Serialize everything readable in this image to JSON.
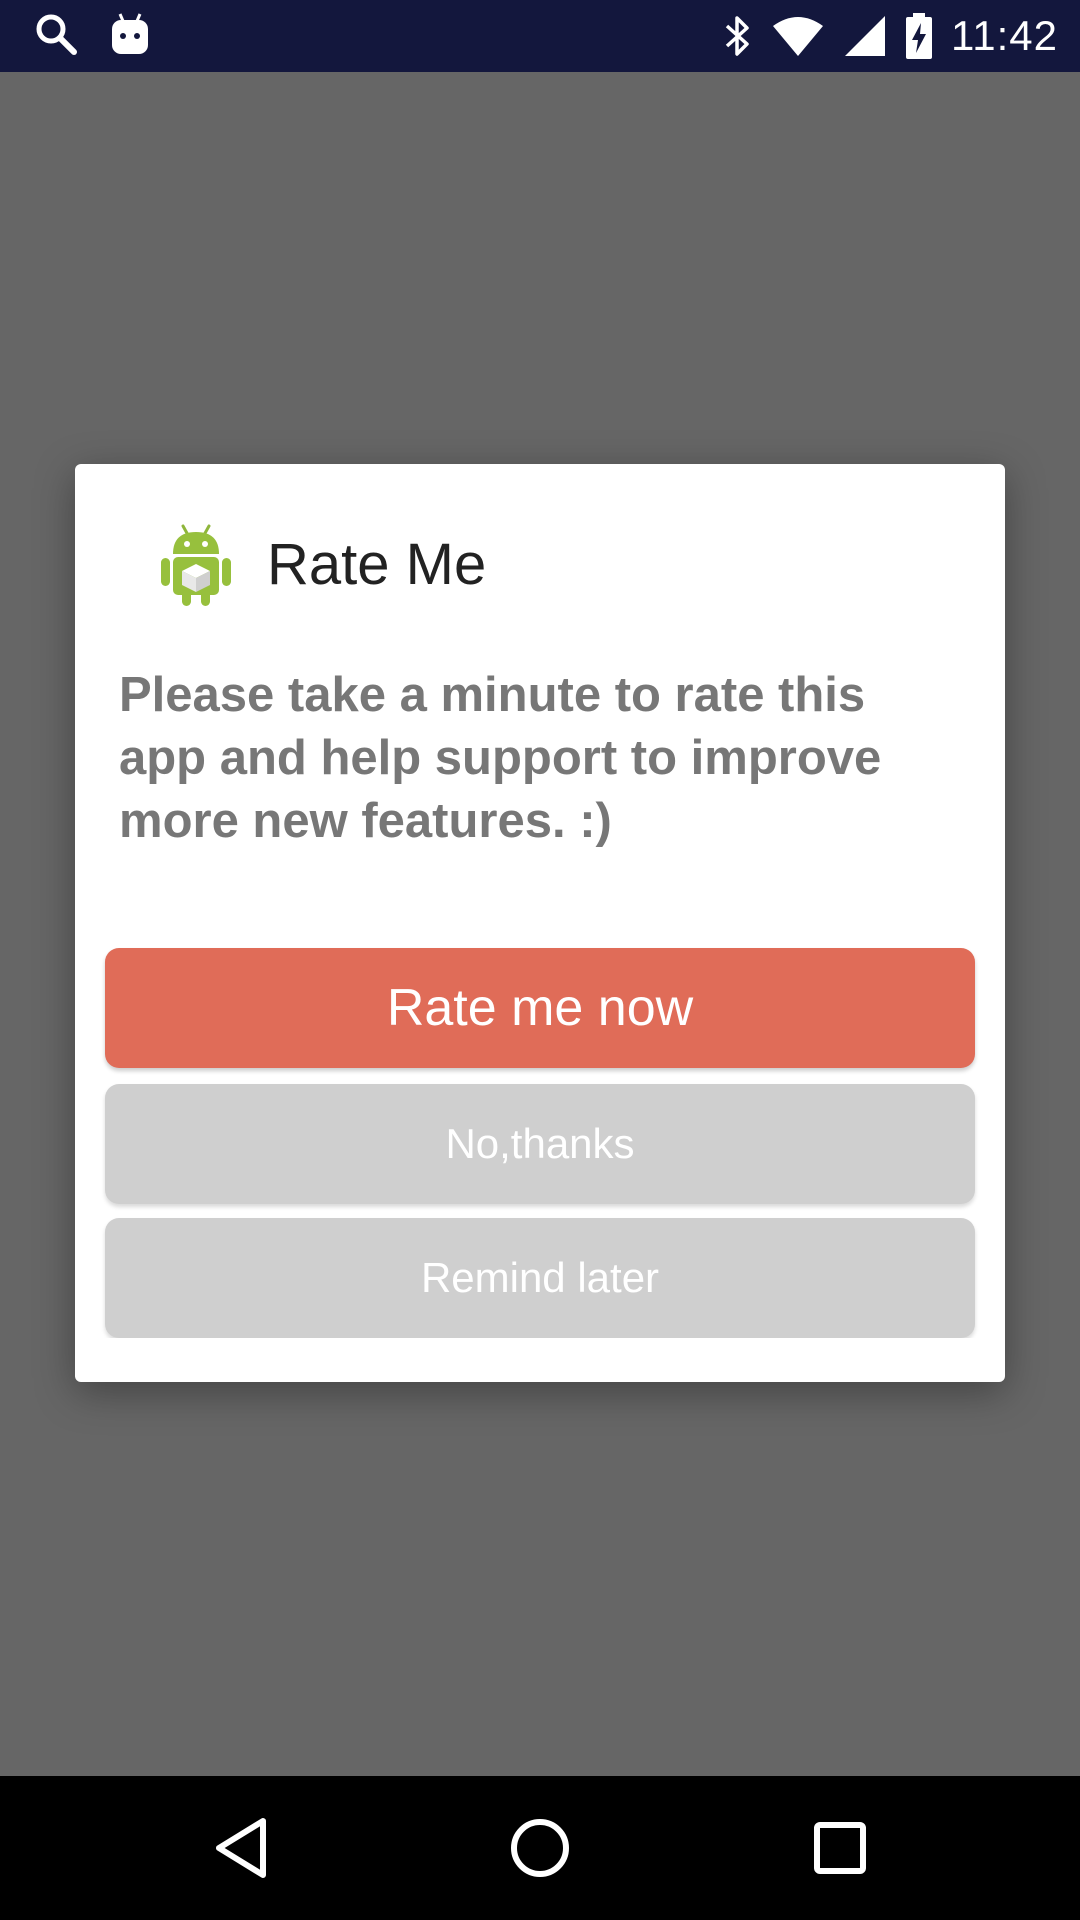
{
  "status_bar": {
    "time": "11:42",
    "left_icons": [
      "search-icon",
      "android-notification-icon"
    ],
    "right_icons": [
      "bluetooth-icon",
      "wifi-icon",
      "signal-icon",
      "battery-charging-icon"
    ],
    "background": "#13173d"
  },
  "dialog": {
    "icon": "android-app-icon",
    "title": "Rate Me",
    "message": "Please take a minute to rate this app and help support to improve more new features. :)",
    "buttons": {
      "rate_now": "Rate me now",
      "no_thanks": "No,thanks",
      "remind_later": "Remind later"
    },
    "colors": {
      "primary_button": "#e06c58",
      "secondary_button": "#cfcfcf",
      "message_text": "#777777"
    }
  },
  "nav_bar": {
    "icons": [
      "back-icon",
      "home-icon",
      "recents-icon"
    ]
  }
}
